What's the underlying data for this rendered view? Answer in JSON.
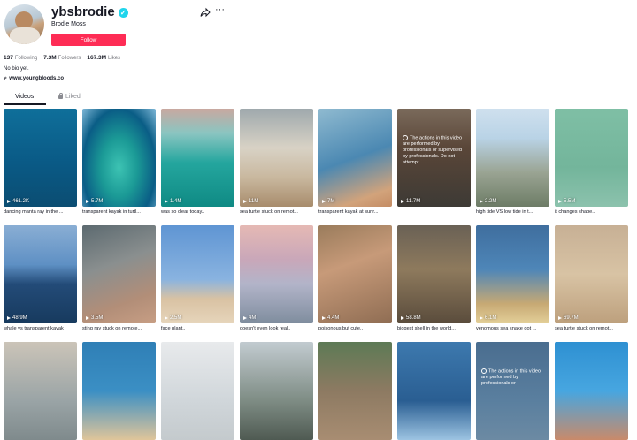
{
  "profile": {
    "handle": "ybsbrodie",
    "display_name": "Brodie Moss",
    "follow_label": "Follow",
    "more_label": "···",
    "stats": [
      {
        "value": "137",
        "label": "Following"
      },
      {
        "value": "7.3M",
        "label": "Followers"
      },
      {
        "value": "167.3M",
        "label": "Likes"
      }
    ],
    "bio": "No bio yet.",
    "link": "www.youngbloods.co"
  },
  "tabs": {
    "videos": "Videos",
    "liked": "Liked"
  },
  "videos": [
    {
      "views": "461.2K",
      "caption": "dancing manta ray in the ..."
    },
    {
      "views": "5.7M",
      "caption": "transparent kayak in turtl..."
    },
    {
      "views": "1.4M",
      "caption": "was so clear today.."
    },
    {
      "views": "11M",
      "caption": "sea turtle stuck on remot..."
    },
    {
      "views": "7M",
      "caption": "transparent kayak at sunr..."
    },
    {
      "views": "11.7M",
      "caption": "",
      "overlay": "The actions in this video are performed by professionals or supervised by professionals. Do not attempt."
    },
    {
      "views": "2.2M",
      "caption": "high tide VS low tide in t..."
    },
    {
      "views": "5.5M",
      "caption": "it changes shape.."
    },
    {
      "views": "48.9M",
      "caption": "whale vs transparent kayak"
    },
    {
      "views": "3.5M",
      "caption": "sting ray stuck on remote..."
    },
    {
      "views": "2.5M",
      "caption": "face plant.."
    },
    {
      "views": "4M",
      "caption": "doesn't even look real.."
    },
    {
      "views": "4.4M",
      "caption": "poisonous but cute.."
    },
    {
      "views": "58.8M",
      "caption": "biggest shell in the world..."
    },
    {
      "views": "6.1M",
      "caption": "venomous sea snake got ..."
    },
    {
      "views": "69.7M",
      "caption": "sea turtle stuck on remot..."
    },
    {
      "views": "",
      "caption": ""
    },
    {
      "views": "",
      "caption": ""
    },
    {
      "views": "",
      "caption": ""
    },
    {
      "views": "",
      "caption": ""
    },
    {
      "views": "",
      "caption": ""
    },
    {
      "views": "",
      "caption": ""
    },
    {
      "views": "",
      "caption": "",
      "overlay": "The actions in this video are performed by professionals or"
    },
    {
      "views": "",
      "caption": ""
    }
  ],
  "colors": {
    "follow": "#fe2c55",
    "verified": "#20d5ec",
    "text": "#161823",
    "muted": "#75767c"
  }
}
